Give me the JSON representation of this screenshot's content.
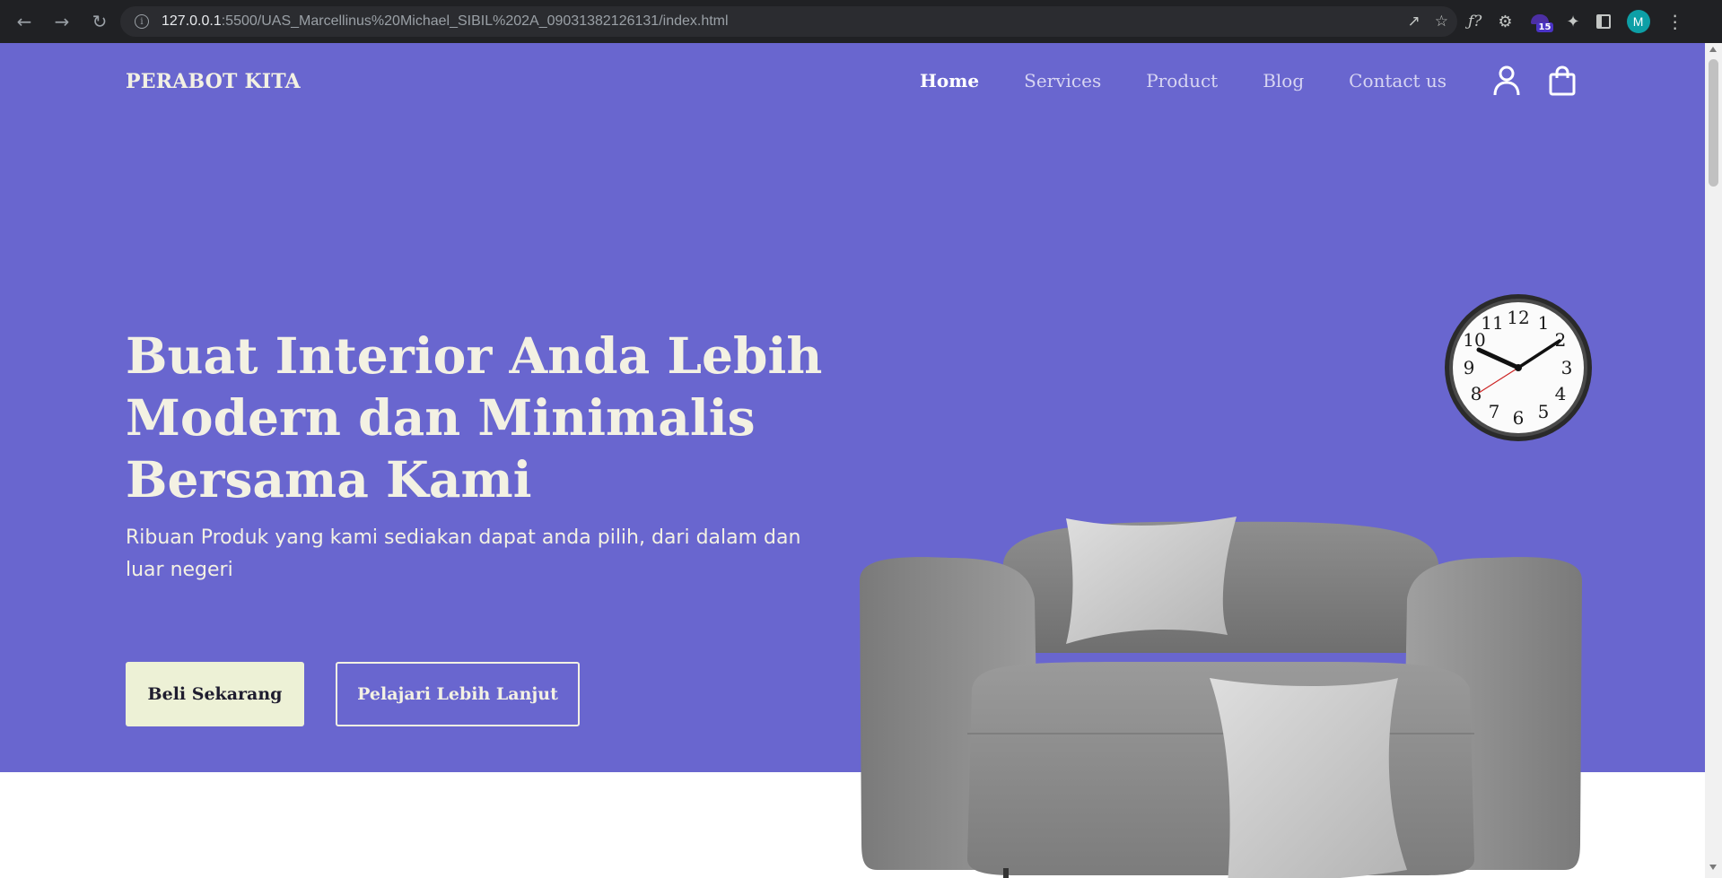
{
  "browser": {
    "back_icon": "arrow-left-icon",
    "forward_icon": "arrow-right-icon",
    "reload_icon": "reload-icon",
    "url_host": "127.0.0.1",
    "url_rest": ":5500/UAS_Marcellinus%20Michael_SIBIL%202A_09031382126131/index.html",
    "extension_badge": "15",
    "profile_initial": "M"
  },
  "site": {
    "brand": "PERABOT KITA",
    "nav": [
      {
        "label": "Home",
        "active": true
      },
      {
        "label": "Services",
        "active": false
      },
      {
        "label": "Product",
        "active": false
      },
      {
        "label": "Blog",
        "active": false
      },
      {
        "label": "Contact us",
        "active": false
      }
    ],
    "user_icon": "user-icon",
    "cart_icon": "shopping-bag-icon"
  },
  "hero": {
    "headline_line1": "Buat Interior Anda Lebih",
    "headline_line2": "Modern dan Minimalis",
    "headline_line3": "Bersama Kami",
    "subtitle": "Ribuan Produk yang kami sediakan dapat anda pilih, dari dalam dan luar negeri",
    "primary_button": "Beli Sekarang",
    "secondary_button": "Pelajari Lebih Lanjut",
    "clock_numbers": [
      "12",
      "1",
      "2",
      "3",
      "4",
      "5",
      "6",
      "7",
      "8",
      "9",
      "10",
      "11"
    ]
  },
  "colors": {
    "hero_bg": "#6966cf",
    "heading": "#f3f1e3",
    "primary_button_bg": "#edf1d6"
  }
}
